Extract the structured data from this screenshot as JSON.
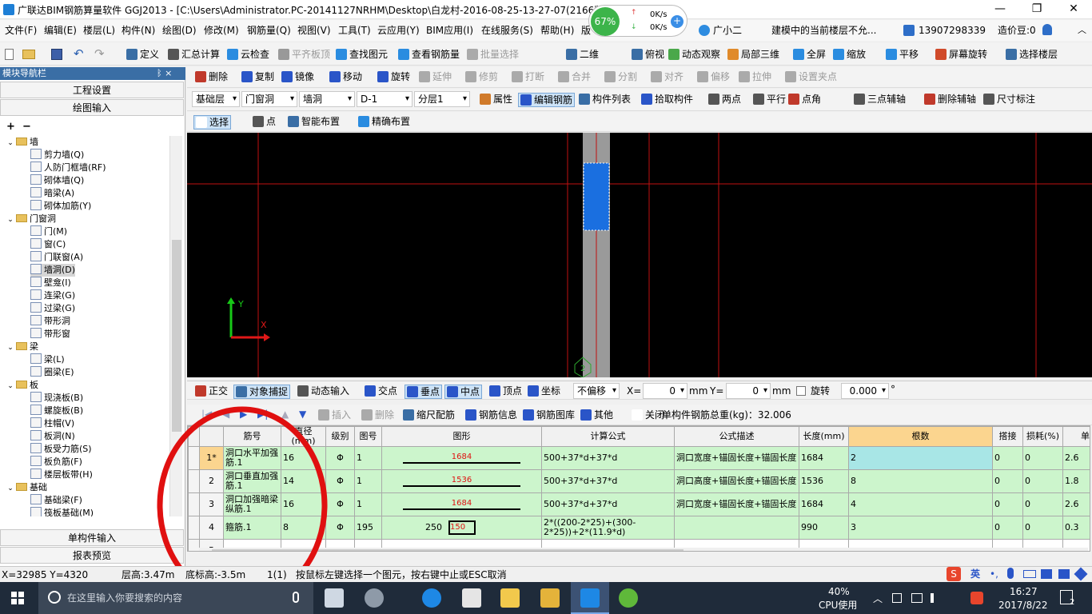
{
  "window": {
    "title": "广联达BIM钢筋算量软件 GGJ2013 - [C:\\Users\\Administrator.PC-20141127NRHM\\Desktop\\白龙村-2016-08-25-13-27-07(2166版本).GGJ12]",
    "minimize": "—",
    "restore": "❐",
    "close": "✕"
  },
  "perf": {
    "percent": "67%",
    "up": "0K/s",
    "down": "0K/s",
    "plus": "+"
  },
  "menubar": {
    "items": [
      "文件(F)",
      "编辑(E)",
      "楼层(L)",
      "构件(N)",
      "绘图(D)",
      "修改(M)",
      "钢筋量(Q)",
      "视图(V)",
      "工具(T)",
      "云应用(Y)",
      "BIM应用(I)",
      "在线服务(S)",
      "帮助(H)",
      "版"
    ],
    "assistant": "广小二",
    "notice": "建模中的当前楼层不允...",
    "phone": "13907298339",
    "cost": "造价豆:0"
  },
  "toolbar1": {
    "items": [
      "定义",
      "汇总计算",
      "云检查",
      "平齐板顶",
      "查找图元",
      "查看钢筋量",
      "批量选择",
      "二维",
      "俯视",
      "动态观察",
      "局部三维",
      "全屏",
      "缩放",
      "平移",
      "屏幕旋转",
      "选择楼层"
    ]
  },
  "toolbar2": {
    "items": [
      "删除",
      "复制",
      "镜像",
      "移动",
      "旋转",
      "延伸",
      "修剪",
      "打断",
      "合并",
      "分割",
      "对齐",
      "偏移",
      "拉伸",
      "设置夹点"
    ]
  },
  "toolbar3": {
    "floor": "基础层",
    "type": "门窗洞",
    "sub": "墙洞",
    "name": "D-1",
    "layer": "分层1",
    "items": [
      "属性",
      "编辑钢筋",
      "构件列表",
      "拾取构件",
      "两点",
      "平行",
      "点角",
      "三点辅轴",
      "删除辅轴",
      "尺寸标注"
    ]
  },
  "toolbar4": {
    "items": [
      "选择",
      "点",
      "智能布置",
      "精确布置"
    ]
  },
  "nav": {
    "header": "模块导航栏",
    "pin": "ᛒ ×",
    "project": "工程设置",
    "draw": "绘图输入",
    "single": "单构件输入",
    "report": "报表预览",
    "tree": [
      {
        "label": "墙",
        "type": "folder",
        "level": 0
      },
      {
        "label": "剪力墙(Q)",
        "type": "leaf",
        "level": 1
      },
      {
        "label": "人防门框墙(RF)",
        "type": "leaf",
        "level": 1
      },
      {
        "label": "砌体墙(Q)",
        "type": "leaf",
        "level": 1
      },
      {
        "label": "暗梁(A)",
        "type": "leaf",
        "level": 1
      },
      {
        "label": "砌体加筋(Y)",
        "type": "leaf",
        "level": 1
      },
      {
        "label": "门窗洞",
        "type": "folder",
        "level": 0
      },
      {
        "label": "门(M)",
        "type": "leaf",
        "level": 1
      },
      {
        "label": "窗(C)",
        "type": "leaf",
        "level": 1
      },
      {
        "label": "门联窗(A)",
        "type": "leaf",
        "level": 1
      },
      {
        "label": "墙洞(D)",
        "type": "leaf",
        "level": 1,
        "selected": true
      },
      {
        "label": "壁龛(I)",
        "type": "leaf",
        "level": 1
      },
      {
        "label": "连梁(G)",
        "type": "leaf",
        "level": 1
      },
      {
        "label": "过梁(G)",
        "type": "leaf",
        "level": 1
      },
      {
        "label": "带形洞",
        "type": "leaf",
        "level": 1
      },
      {
        "label": "带形窗",
        "type": "leaf",
        "level": 1
      },
      {
        "label": "梁",
        "type": "folder",
        "level": 0
      },
      {
        "label": "梁(L)",
        "type": "leaf",
        "level": 1
      },
      {
        "label": "圈梁(E)",
        "type": "leaf",
        "level": 1
      },
      {
        "label": "板",
        "type": "folder",
        "level": 0
      },
      {
        "label": "现浇板(B)",
        "type": "leaf",
        "level": 1
      },
      {
        "label": "螺旋板(B)",
        "type": "leaf",
        "level": 1
      },
      {
        "label": "柱帽(V)",
        "type": "leaf",
        "level": 1
      },
      {
        "label": "板洞(N)",
        "type": "leaf",
        "level": 1
      },
      {
        "label": "板受力筋(S)",
        "type": "leaf",
        "level": 1
      },
      {
        "label": "板负筋(F)",
        "type": "leaf",
        "level": 1
      },
      {
        "label": "楼层板带(H)",
        "type": "leaf",
        "level": 1
      },
      {
        "label": "基础",
        "type": "folder",
        "level": 0
      },
      {
        "label": "基础梁(F)",
        "type": "leaf",
        "level": 1
      },
      {
        "label": "筏板基础(M)",
        "type": "leaf",
        "level": 1
      }
    ]
  },
  "canvas": {
    "axis_x": "X",
    "axis_y": "Y",
    "marker": "2"
  },
  "snapbar": {
    "items": [
      "正交",
      "对象捕捉",
      "动态输入",
      "交点",
      "垂点",
      "中点",
      "顶点",
      "坐标"
    ],
    "offset": "不偏移",
    "x_label": "X=",
    "x_val": "0",
    "y_label": "Y=",
    "y_val": "0",
    "unit": "mm",
    "rotate": "旋转",
    "rotate_val": "0.000",
    "deg": "°"
  },
  "rebarbar": {
    "items": [
      "插入",
      "删除",
      "缩尺配筋",
      "钢筋信息",
      "钢筋图库",
      "其他",
      "关闭"
    ],
    "total": "单构件钢筋总重(kg)：32.006"
  },
  "grid": {
    "headers": [
      "筋号",
      "直径(mm)",
      "级别",
      "图号",
      "图形",
      "计算公式",
      "公式描述",
      "长度(mm)",
      "根数",
      "搭接",
      "损耗(%)",
      "单"
    ],
    "rows": [
      {
        "no": "1*",
        "name": "洞口水平加强筋.1",
        "dia": "16",
        "grade": "Φ",
        "fig": "1",
        "shape": "1684",
        "formula": "500+37*d+37*d",
        "desc": "洞口宽度+锚固长度+锚固长度",
        "len": "1684",
        "count": "2",
        "lap": "0",
        "loss": "0",
        "unit": "2.6"
      },
      {
        "no": "2",
        "name": "洞口垂直加强筋.1",
        "dia": "14",
        "grade": "Φ",
        "fig": "1",
        "shape": "1536",
        "formula": "500+37*d+37*d",
        "desc": "洞口高度+锚固长度+锚固长度",
        "len": "1536",
        "count": "8",
        "lap": "0",
        "loss": "0",
        "unit": "1.8"
      },
      {
        "no": "3",
        "name": "洞口加强暗梁纵筋.1",
        "dia": "16",
        "grade": "Φ",
        "fig": "1",
        "shape": "1684",
        "formula": "500+37*d+37*d",
        "desc": "洞口宽度+锚固长度+锚固长度",
        "len": "1684",
        "count": "4",
        "lap": "0",
        "loss": "0",
        "unit": "2.6"
      },
      {
        "no": "4",
        "name": "箍筋.1",
        "dia": "8",
        "grade": "Φ",
        "fig": "195",
        "shape": "150",
        "shape2": "250",
        "formula": "2*((200-2*25)+(300-2*25))+2*(11.9*d)",
        "desc": "",
        "len": "990",
        "count": "3",
        "lap": "0",
        "loss": "0",
        "unit": "0.3"
      },
      {
        "no": "5",
        "name": "",
        "dia": "",
        "grade": "",
        "fig": "",
        "shape": "",
        "formula": "",
        "desc": "",
        "len": "",
        "count": "",
        "lap": "",
        "loss": "",
        "unit": ""
      }
    ]
  },
  "status": {
    "coords": "X=32985 Y=4320",
    "floor_h": "层高:3.47m",
    "base_h": "底标高:-3.5m",
    "count": "1(1)",
    "hint": "按鼠标左键选择一个图元，按右键中止或ESC取消",
    "ime": "英"
  },
  "taskbar": {
    "search": "在这里输入你要搜索的内容",
    "cpu": "40%",
    "cpu_label": "CPU使用",
    "time": "16:27",
    "date": "2017/8/22",
    "badge": "2"
  },
  "colors": {
    "accent": "#0078d7",
    "canvas": "#000000",
    "rebar_row": "#ccf5cc",
    "highlight": "#fbd58f",
    "annotation": "#e01010"
  }
}
